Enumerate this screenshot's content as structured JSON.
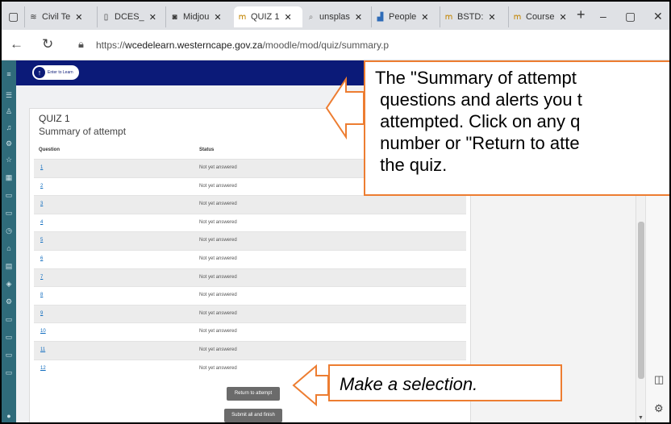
{
  "browser": {
    "tabs": [
      {
        "label": "Civil Te",
        "icon": "civil-icon"
      },
      {
        "label": "DCES_",
        "icon": "doc-icon"
      },
      {
        "label": "Midjou",
        "icon": "midjourney-icon"
      },
      {
        "label": "QUIZ 1",
        "icon": "moodle-icon",
        "active": true
      },
      {
        "label": "unsplas",
        "icon": "search-icon"
      },
      {
        "label": "People",
        "icon": "people-icon"
      },
      {
        "label": "BSTD:",
        "icon": "moodle-icon"
      },
      {
        "label": "Course",
        "icon": "moodle-icon"
      }
    ],
    "url_prefix": "https://",
    "url_host": "wcedelearn.westerncape.gov.za",
    "url_path": "/moodle/mod/quiz/summary.p"
  },
  "site": {
    "logo_text": "Enter to Learn"
  },
  "quiz": {
    "title": "QUIZ 1",
    "subtitle": "Summary of attempt",
    "col_question": "Question",
    "col_status": "Status",
    "rows": [
      {
        "q": "1",
        "status": "Not yet answered"
      },
      {
        "q": "2",
        "status": "Not yet answered"
      },
      {
        "q": "3",
        "status": "Not yet answered"
      },
      {
        "q": "4",
        "status": "Not yet answered"
      },
      {
        "q": "5",
        "status": "Not yet answered"
      },
      {
        "q": "6",
        "status": "Not yet answered"
      },
      {
        "q": "7",
        "status": "Not yet answered"
      },
      {
        "q": "8",
        "status": "Not yet answered"
      },
      {
        "q": "9",
        "status": "Not yet answered"
      },
      {
        "q": "10",
        "status": "Not yet answered"
      },
      {
        "q": "11",
        "status": "Not yet answered"
      },
      {
        "q": "12",
        "status": "Not yet answered"
      }
    ],
    "return_button": "Return to attempt",
    "submit_button": "Submit all and finish"
  },
  "callouts": {
    "summary_note": "The \"Summary of attempt\n questions and alerts you t\n attempted. Click on any q\n number or \"Return to atte\n the quiz.",
    "selection_note": "Make a selection."
  },
  "colors": {
    "accent": "#ed7d31",
    "banner": "#0b1a78",
    "sidebar": "#2f6b7a",
    "button": "#6b6b6b"
  }
}
